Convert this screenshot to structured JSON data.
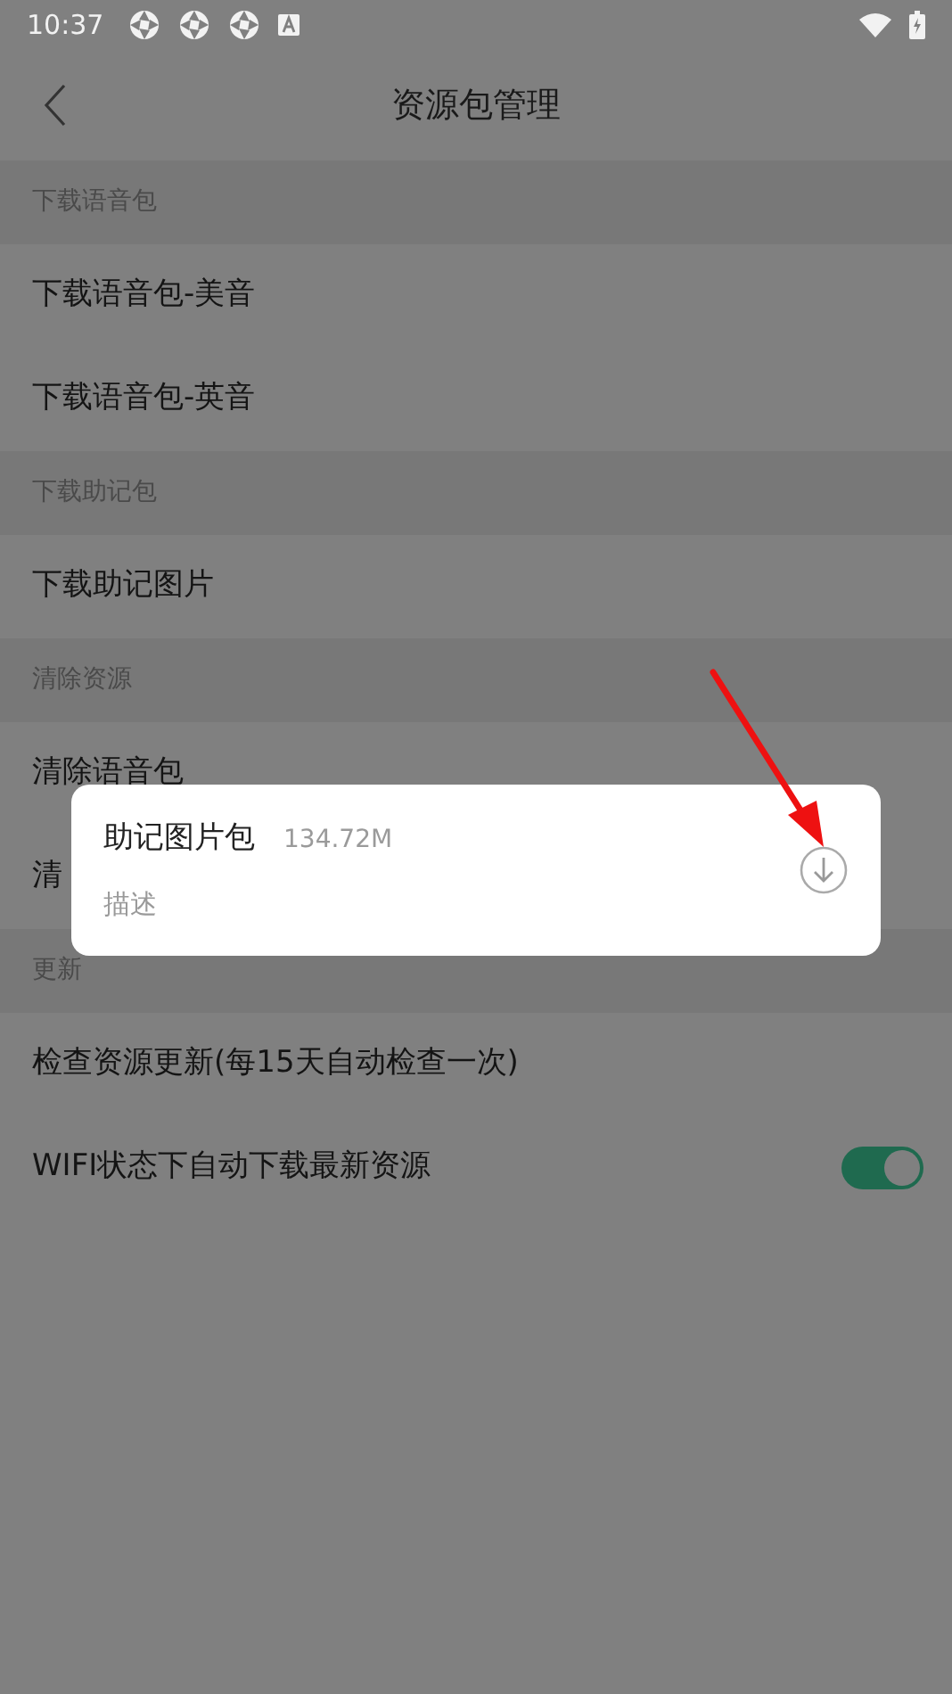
{
  "status_bar": {
    "time": "10:37"
  },
  "header": {
    "title": "资源包管理"
  },
  "sections": [
    {
      "title": "下载语音包",
      "rows": [
        {
          "kind": "plain",
          "label": "下载语音包-美音"
        },
        {
          "kind": "plain",
          "label": "下载语音包-英音"
        }
      ]
    },
    {
      "title": "下载助记包",
      "rows": [
        {
          "kind": "plain",
          "label": "下载助记图片"
        }
      ]
    },
    {
      "title": "清除资源",
      "rows": [
        {
          "kind": "plain",
          "label": "清除语音包"
        },
        {
          "kind": "plain",
          "label": "清"
        }
      ]
    },
    {
      "title": "更新",
      "rows": [
        {
          "kind": "plain",
          "label": "检查资源更新(每15天自动检查一次)"
        },
        {
          "kind": "toggle",
          "label": "WIFI状态下自动下载最新资源",
          "on": true
        }
      ]
    }
  ],
  "dialog": {
    "name": "助记图片包",
    "size": "134.72M",
    "description": "描述"
  }
}
